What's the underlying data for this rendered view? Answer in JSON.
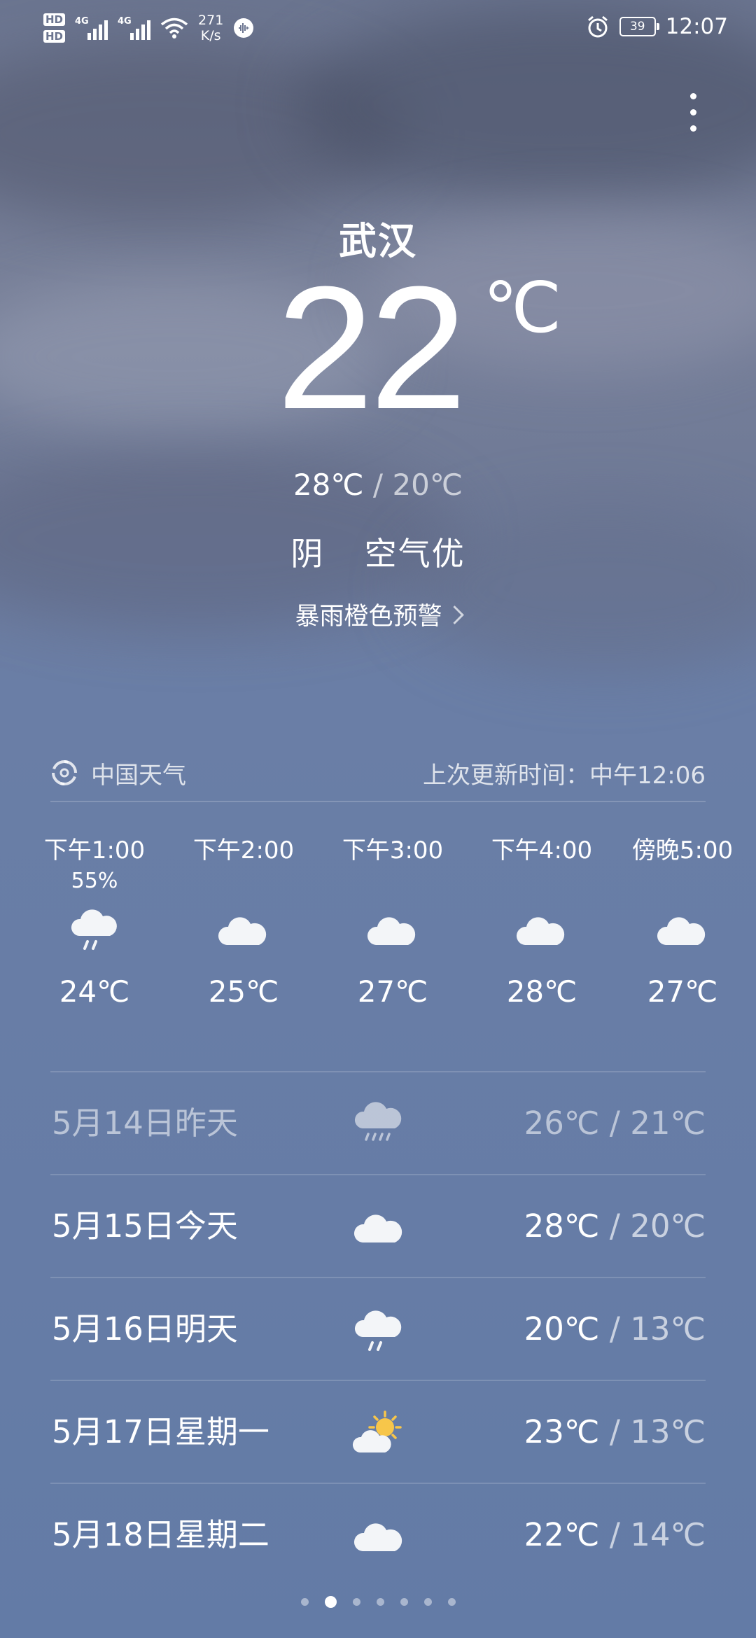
{
  "status_bar": {
    "hd1": "HD",
    "hd2": "HD",
    "net1": "4G",
    "net2": "4G",
    "speed_value": "271",
    "speed_unit": "K/s",
    "battery": "39",
    "time": "12:07",
    "icons": [
      "hd-icon",
      "signal-icon",
      "signal-icon",
      "wifi-icon",
      "audio-icon",
      "alarm-icon",
      "battery-icon"
    ]
  },
  "current": {
    "city": "武汉",
    "temperature": "22",
    "unit": "℃",
    "high": "28℃",
    "separator": "/",
    "low": "20℃",
    "condition": "阴",
    "air_quality": "空气优",
    "alert": "暴雨橙色预警"
  },
  "source": {
    "name": "中国天气",
    "updated": "上次更新时间：中午12:06"
  },
  "hourly": [
    {
      "time": "下午1:00",
      "pop": "55%",
      "icon": "rain-cloud-icon",
      "temp": "24℃"
    },
    {
      "time": "下午2:00",
      "pop": "",
      "icon": "cloud-icon",
      "temp": "25℃"
    },
    {
      "time": "下午3:00",
      "pop": "",
      "icon": "cloud-icon",
      "temp": "27℃"
    },
    {
      "time": "下午4:00",
      "pop": "",
      "icon": "cloud-icon",
      "temp": "28℃"
    },
    {
      "time": "傍晚5:00",
      "pop": "",
      "icon": "cloud-icon",
      "temp": "27℃"
    }
  ],
  "daily": [
    {
      "date": "5月14日昨天",
      "icon": "heavy-rain-icon",
      "high": "26℃",
      "sep": " / ",
      "low": "21℃"
    },
    {
      "date": "5月15日今天",
      "icon": "cloud-icon",
      "high": "28℃",
      "sep": " / ",
      "low": "20℃"
    },
    {
      "date": "5月16日明天",
      "icon": "rain-cloud-icon",
      "high": "20℃",
      "sep": " / ",
      "low": "13℃"
    },
    {
      "date": "5月17日星期一",
      "icon": "partly-sunny-icon",
      "high": "23℃",
      "sep": " / ",
      "low": "13℃"
    },
    {
      "date": "5月18日星期二",
      "icon": "cloud-icon",
      "high": "22℃",
      "sep": " / ",
      "low": "14℃"
    }
  ],
  "pager": {
    "count": 7,
    "active": 1
  },
  "colors": {
    "sky_top": "#6b7590",
    "sky_bottom": "#637ba6",
    "sun": "#f7c64a"
  }
}
